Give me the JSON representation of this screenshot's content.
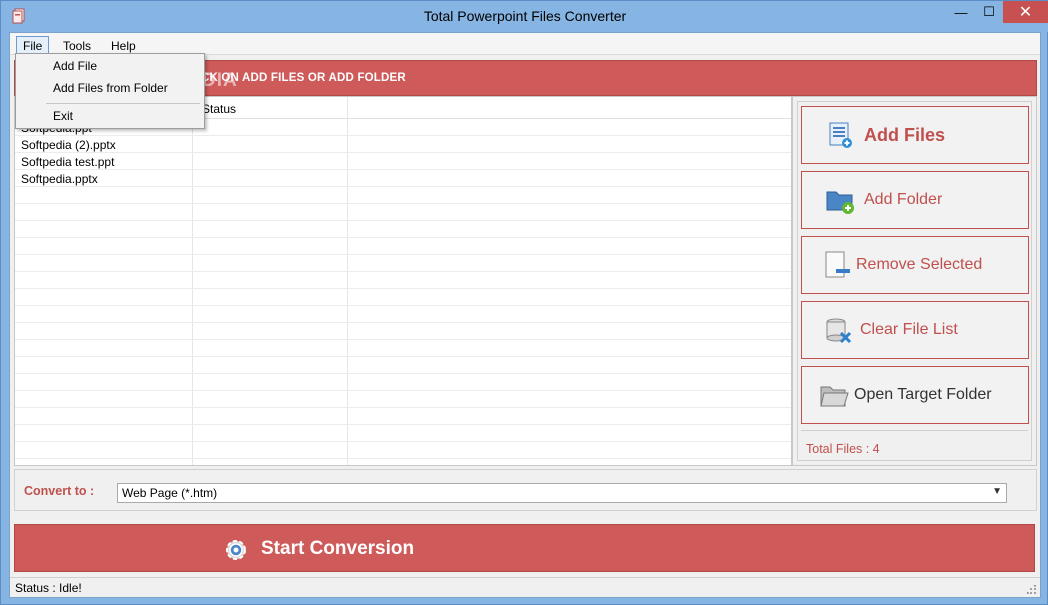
{
  "window": {
    "title": "Total Powerpoint Files Converter",
    "minimize_glyph": "—",
    "maximize_glyph": "☐",
    "close_glyph": "✕"
  },
  "menu": {
    "file": "File",
    "tools": "Tools",
    "help": "Help",
    "file_dropdown": {
      "add_file": "Add File",
      "add_files_from_folder": "Add Files from Folder",
      "exit": "Exit"
    }
  },
  "banner": {
    "text": "CK ON ADD FILES OR ADD FOLDER",
    "watermark": "SOFTPEDIA"
  },
  "file_list": {
    "columns": [
      "",
      "Status"
    ],
    "rows": [
      {
        "name": "Softpedia.ppt",
        "status": ""
      },
      {
        "name": "Softpedia (2).pptx",
        "status": ""
      },
      {
        "name": "Softpedia test.ppt",
        "status": ""
      },
      {
        "name": "Softpedia.pptx",
        "status": ""
      }
    ]
  },
  "actions": {
    "add_files": "Add Files",
    "add_folder": "Add Folder",
    "remove_selected": "Remove Selected",
    "clear_file_list": "Clear File List",
    "open_target_folder": "Open Target Folder",
    "total_files": "Total Files : 4"
  },
  "convert": {
    "label": "Convert to :",
    "selected": "Web Page (*.htm)"
  },
  "start": {
    "label": "Start Conversion"
  },
  "status": {
    "text": "Status  :  Idle!"
  },
  "colors": {
    "accent_red": "#cf5a5a",
    "label_red": "#c0504d",
    "title_blue": "#86b4e3",
    "close_red": "#c75050"
  },
  "icons": {
    "app": "document-stack-icon",
    "add_files": "file-list-add-icon",
    "add_folder": "folder-add-icon",
    "remove_selected": "document-remove-icon",
    "clear_file_list": "database-delete-icon",
    "open_target_folder": "folder-open-icon",
    "start": "gear-icon"
  }
}
